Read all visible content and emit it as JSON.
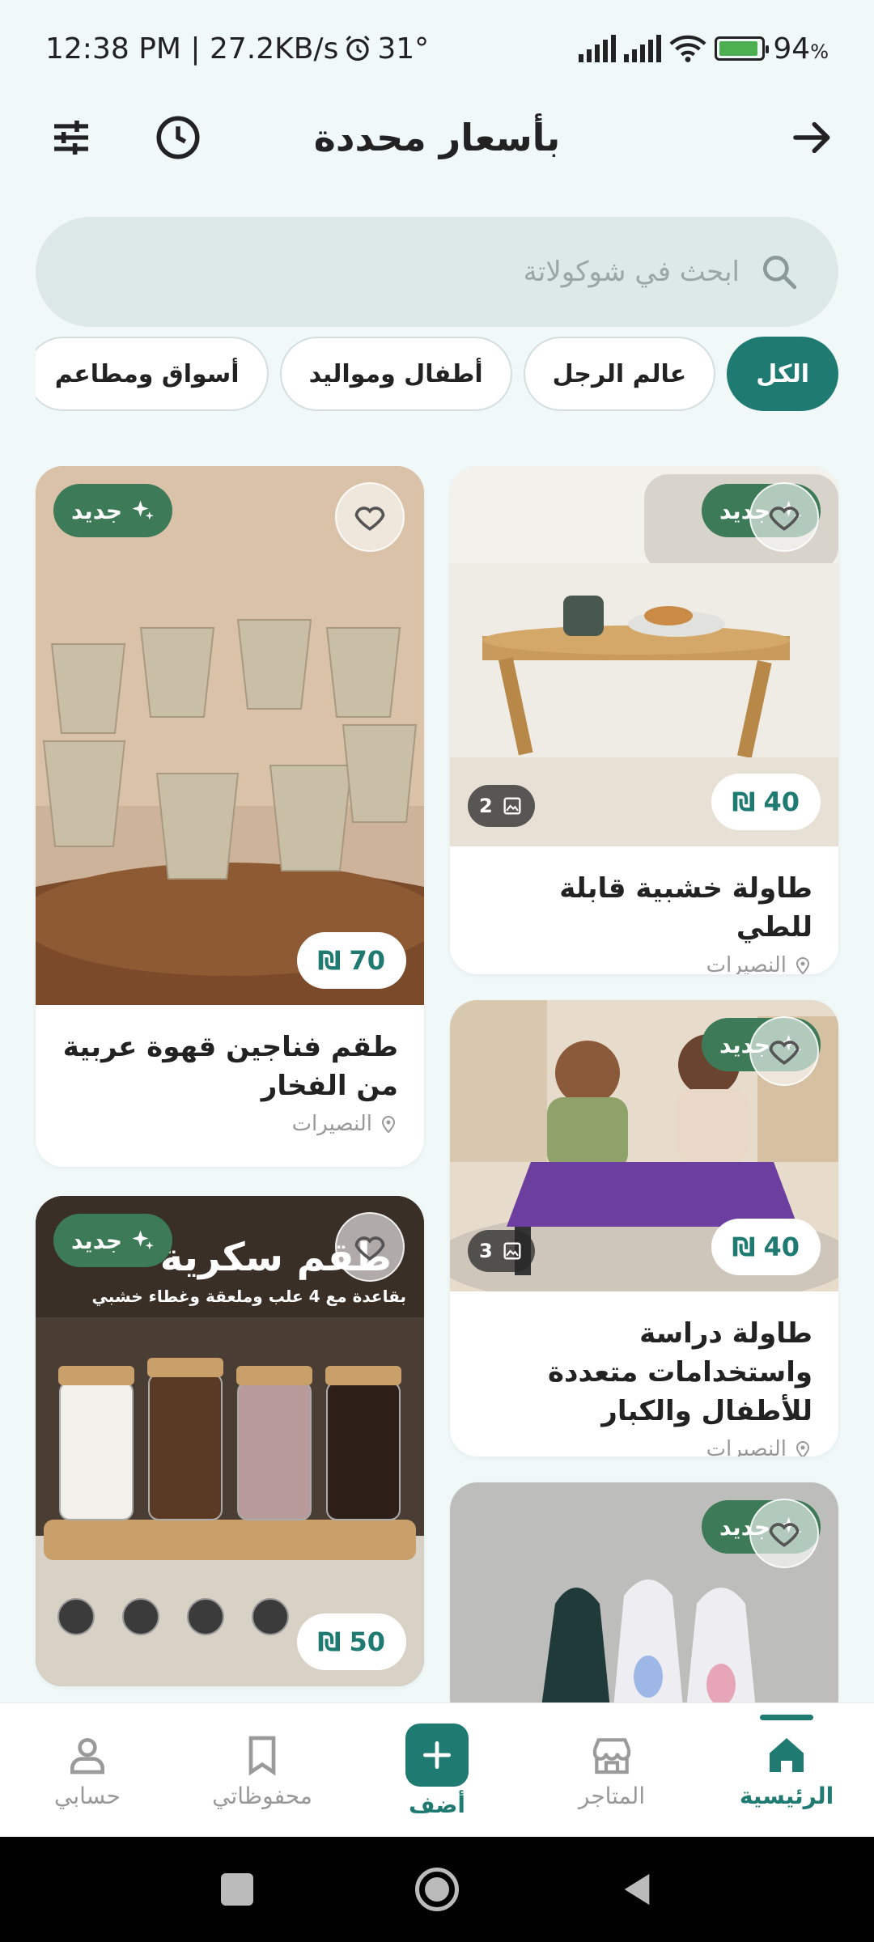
{
  "status_bar": {
    "time_info": "12:38 PM | 27.2KB/s",
    "temperature": "31°",
    "battery": "94",
    "battery_unit": "%",
    "battery_level": 0.94
  },
  "header": {
    "title": "بأسعار محددة",
    "back_icon": "arrow-right-icon",
    "history_icon": "clock-icon",
    "filter_icon": "sliders-icon"
  },
  "search": {
    "placeholder": "ابحث في شوكولاتة"
  },
  "categories": [
    {
      "label": "الكل",
      "active": true
    },
    {
      "label": "عالم الرجل",
      "active": false
    },
    {
      "label": "أطفال ومواليد",
      "active": false
    },
    {
      "label": "أسواق ومطاعم",
      "active": false
    }
  ],
  "products": {
    "badge_label": "جديد",
    "currency": "₪",
    "items": [
      {
        "title": "طاولة خشبية قابلة للطي",
        "location": "النصيرات",
        "price": "40",
        "photos": "2"
      },
      {
        "title": "طقم فناجين قهوة عربية من الفخار",
        "location": "النصيرات",
        "price": "70"
      },
      {
        "title": "طاولة دراسة واستخدامات متعددة للأطفال والكبار",
        "location": "النصيرات",
        "price": "40",
        "photos": "3"
      },
      {
        "price": "50",
        "banner_title": "طقم سكرية",
        "banner_subtitle": "بقاعدة مع 4 علب وملعقة وغطاء خشبي"
      },
      {}
    ]
  },
  "bottom_nav": {
    "home": "الرئيسية",
    "stores": "المتاجر",
    "add": "أضف",
    "saved": "محفوظاتي",
    "account": "حسابي"
  },
  "colors": {
    "accent": "#1f7b72",
    "badge": "#3d7a58",
    "background": "#f1f8f8"
  }
}
